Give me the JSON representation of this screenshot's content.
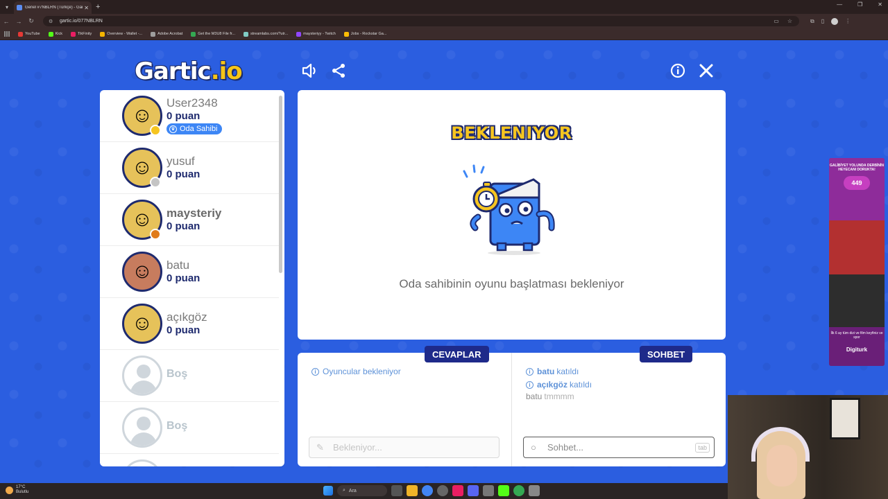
{
  "browser": {
    "tab_title": "Genel #7NBLRN (Türkçe) - Gar",
    "url": "gartic.io/077NBLRN",
    "bookmarks": [
      {
        "label": "YouTube",
        "color": "#e53935"
      },
      {
        "label": "Kick",
        "color": "#53fc18"
      },
      {
        "label": "TikFinity",
        "color": "#e91e63"
      },
      {
        "label": "Overview - Wallet -...",
        "color": "#f4b400"
      },
      {
        "label": "Adobe Acrobat",
        "color": "#9e9e9e"
      },
      {
        "label": "Get the M3U8 File fr...",
        "color": "#34a853"
      },
      {
        "label": "streamlabs.com/?utr...",
        "color": "#80cbc4"
      },
      {
        "label": "maysteriyy - Twitch",
        "color": "#9146ff"
      },
      {
        "label": "Jobs - Rockstar Ga...",
        "color": "#fbbc05"
      }
    ]
  },
  "game": {
    "logo_main": "Gartic",
    "logo_suffix": ".io",
    "players": [
      {
        "name": "User2348",
        "score": "0 puan",
        "badge": "Oda Sahibi",
        "status_color": "#f6c520"
      },
      {
        "name": "yusuf",
        "score": "0 puan",
        "status_color": "#c4c4c4"
      },
      {
        "name": "maysteriy",
        "score": "0 puan",
        "status_color": "#e07b1a"
      },
      {
        "name": "batu",
        "score": "0 puan"
      },
      {
        "name": "açıkgöz",
        "score": "0 puan"
      },
      {
        "name": "Boş"
      },
      {
        "name": "Boş"
      }
    ],
    "status_title": "BEKLENIYOR",
    "status_message": "Oda sahibinin oyunu başlatması bekleniyor",
    "answers": {
      "label": "CEVAPLAR",
      "message": "Oyuncular bekleniyor",
      "placeholder": "Bekleniyor..."
    },
    "chat": {
      "label": "SOHBET",
      "messages": [
        {
          "user": "batu",
          "text": "katıldı"
        },
        {
          "user": "açıkgöz",
          "text": "katıldı"
        }
      ],
      "chat_line": {
        "user": "batu",
        "text": "tmmmm"
      },
      "placeholder": "Sohbet...",
      "key_hint": "tab"
    },
    "colors": {
      "background": "#2b5ee0",
      "accent_yellow": "#f6c520",
      "navy": "#1e2a8a"
    }
  },
  "ad": {
    "headline": "GALİBİYET YOLUNDA DERBİNİN HEYECANI DORUKTA!",
    "price": "449",
    "tagline": "İlk 6 ay tüm dizi ve film keyfiniz ve spor",
    "brand": "Digiturk"
  },
  "taskbar": {
    "temp": "17°C",
    "condition": "Bulutlu",
    "search_label": "Ara"
  }
}
